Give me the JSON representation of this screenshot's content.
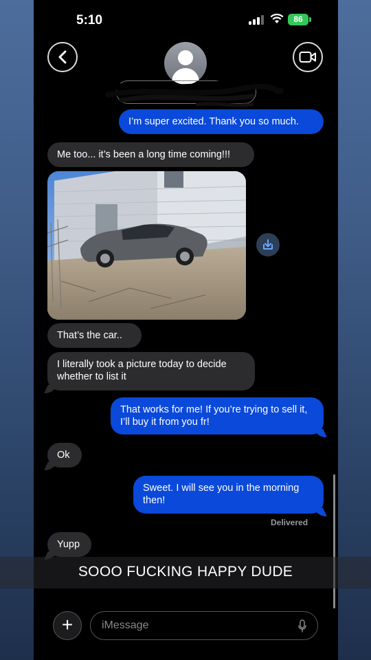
{
  "status_bar": {
    "time": "5:10",
    "battery": "86"
  },
  "messages": [
    {
      "id": "m1",
      "direction": "outgoing",
      "text": "I’m super excited. Thank you so much."
    },
    {
      "id": "m2",
      "direction": "incoming",
      "text": "Me too... it’s been a long time coming!!!"
    },
    {
      "id": "m3",
      "direction": "incoming",
      "type": "photo",
      "description": "car photo"
    },
    {
      "id": "m4",
      "direction": "incoming",
      "text": "That’s the car.."
    },
    {
      "id": "m5",
      "direction": "incoming",
      "text": "I literally took a picture today to decide whether to list it"
    },
    {
      "id": "m6",
      "direction": "outgoing",
      "text": "That works for me! If you’re trying to sell it, I’ll buy it from you fr!"
    },
    {
      "id": "m7",
      "direction": "incoming",
      "text": "Ok"
    },
    {
      "id": "m8",
      "direction": "outgoing",
      "text": "Sweet. I will see you in the morning then!"
    },
    {
      "id": "m9",
      "direction": "incoming",
      "text": "Yupp"
    }
  ],
  "delivered_label": "Delivered",
  "overlay_caption": "SOOO FUCKING HAPPY DUDE",
  "composer": {
    "placeholder": "iMessage"
  },
  "colors": {
    "outgoing": "#0a49d9",
    "incoming": "#2c2c2e",
    "battery": "#34c759"
  },
  "icons": [
    "back-chevron-icon",
    "video-camera-icon",
    "contact-avatar-icon",
    "save-download-icon",
    "plus-icon",
    "microphone-icon",
    "signal-icon",
    "wifi-icon"
  ]
}
